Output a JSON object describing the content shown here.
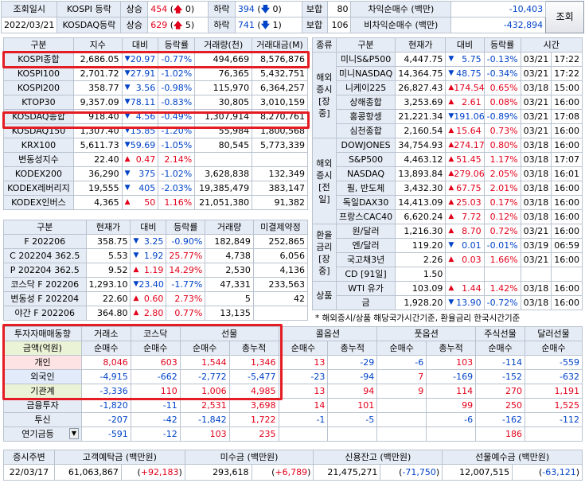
{
  "header": {
    "time_label": "조회일시",
    "date": "2022/03/21",
    "rows": [
      {
        "market": "KOSPI 등락",
        "up_label": "상승",
        "up_count": "454",
        "upper_limit": "0",
        "down_label": "하락",
        "down_count": "394",
        "lower_limit": "0",
        "flat_label": "보합",
        "flat_count": "80",
        "net_label": "차익순매수 (백만)",
        "net_value": "-10,403"
      },
      {
        "market": "KOSDAQ등락",
        "up_label": "상승",
        "up_count": "629",
        "upper_limit": "5",
        "down_label": "하락",
        "down_count": "741",
        "lower_limit": "1",
        "flat_label": "보합",
        "flat_count": "106",
        "net_label": "비차익순매수 (백만)",
        "net_value": "-432,894"
      }
    ],
    "query_button": "조회"
  },
  "index_table": {
    "headers": [
      "구분",
      "지수",
      "대비",
      "등락률",
      "거래량(천)",
      "거래대금(M)"
    ],
    "rows": [
      {
        "name": "KOSPI종합",
        "value": "2,686.05",
        "dir": "down",
        "change": "20.97",
        "rate": "-0.77%",
        "volume": "494,669",
        "amount": "8,576,876"
      },
      {
        "name": "KOSPI100",
        "value": "2,701.72",
        "dir": "down",
        "change": "27.91",
        "rate": "-1.02%",
        "volume": "76,365",
        "amount": "5,432,751"
      },
      {
        "name": "KOSPI200",
        "value": "358.77",
        "dir": "down",
        "change": "3.56",
        "rate": "-0.98%",
        "volume": "115,970",
        "amount": "6,364,257"
      },
      {
        "name": "KTOP30",
        "value": "9,357.09",
        "dir": "down",
        "change": "78.11",
        "rate": "-0.83%",
        "volume": "30,805",
        "amount": "3,010,159"
      },
      {
        "name": "KOSDAQ종합",
        "value": "918.40",
        "dir": "down",
        "change": "4.56",
        "rate": "-0.49%",
        "volume": "1,307,914",
        "amount": "8,270,761"
      },
      {
        "name": "KOSDAQ150",
        "value": "1,307.40",
        "dir": "down",
        "change": "15.85",
        "rate": "-1.20%",
        "volume": "55,984",
        "amount": "1,800,568"
      },
      {
        "name": "KRX100",
        "value": "5,611.73",
        "dir": "down",
        "change": "59.69",
        "rate": "-1.05%",
        "volume": "80,545",
        "amount": "5,773,339"
      },
      {
        "name": "변동성지수",
        "value": "22.40",
        "dir": "up",
        "change": "0.47",
        "rate": "2.14%",
        "volume": "",
        "amount": ""
      },
      {
        "name": "KODEX200",
        "value": "36,290",
        "dir": "down",
        "change": "375",
        "rate": "-1.02%",
        "volume": "3,628,838",
        "amount": "132,349"
      },
      {
        "name": "KODEX레버리지",
        "value": "19,555",
        "dir": "down",
        "change": "405",
        "rate": "-2.03%",
        "volume": "19,385,479",
        "amount": "383,147"
      },
      {
        "name": "KODEX인버스",
        "value": "4,365",
        "dir": "up",
        "change": "50",
        "rate": "1.16%",
        "volume": "21,051,380",
        "amount": "91,382"
      }
    ]
  },
  "futures_table": {
    "headers": [
      "구분",
      "현재가",
      "대비",
      "등락률",
      "거래량",
      "미결제약정"
    ],
    "rows": [
      {
        "name": "F 202206",
        "value": "358.75",
        "dir": "down",
        "change": "3.25",
        "rate": "-0.90%",
        "volume": "182,849",
        "oi": "252,865"
      },
      {
        "name": "C 202204 362.5",
        "value": "5.53",
        "dir": "down",
        "change": "1.92",
        "rate": "25.77%",
        "volume": "4,738",
        "oi": "6,056"
      },
      {
        "name": "P 202204 362.5",
        "value": "9.52",
        "dir": "up",
        "change": "1.19",
        "rate": "14.29%",
        "volume": "2,530",
        "oi": "4,136"
      },
      {
        "name": "코스닥 F 202206",
        "value": "1,293.10",
        "dir": "down",
        "change": "23.40",
        "rate": "-1.77%",
        "volume": "47,331",
        "oi": "233,563"
      },
      {
        "name": "변동성 F 202204",
        "value": "22.60",
        "dir": "up",
        "change": "0.60",
        "rate": "2.73%",
        "volume": "5",
        "oi": "42"
      },
      {
        "name": "야간 F 202206",
        "value": "364.80",
        "dir": "up",
        "change": "2.80",
        "rate": "0.77%",
        "volume": "13,135",
        "oi": ""
      }
    ]
  },
  "world_table": {
    "headers": [
      "종류",
      "구분",
      "현재가",
      "대비",
      "등락률",
      "시간"
    ],
    "groups": [
      {
        "label": "해외 증시 [장중]",
        "rows": [
          {
            "name": "미니S&P500",
            "value": "4,447.75",
            "dir": "down",
            "change": "5.75",
            "rate": "-0.13%",
            "date": "03/21",
            "time": "17:22"
          },
          {
            "name": "미니NASDAQ",
            "value": "14,364.75",
            "dir": "down",
            "change": "48.75",
            "rate": "-0.34%",
            "date": "03/21",
            "time": "17:22"
          },
          {
            "name": "니케이225",
            "value": "26,827.43",
            "dir": "up",
            "change": "174.54",
            "rate": "0.65%",
            "date": "03/18",
            "time": "15:00"
          },
          {
            "name": "상해종합",
            "value": "3,253.69",
            "dir": "up",
            "change": "2.61",
            "rate": "0.08%",
            "date": "03/21",
            "time": "16:00"
          },
          {
            "name": "홍콩항셍",
            "value": "21,221.34",
            "dir": "down",
            "change": "191.06",
            "rate": "-0.89%",
            "date": "03/21",
            "time": "17:08"
          },
          {
            "name": "심천종합",
            "value": "2,160.54",
            "dir": "up",
            "change": "15.64",
            "rate": "0.73%",
            "date": "03/21",
            "time": "16:00"
          }
        ]
      },
      {
        "label": "해외 증시 [전일]",
        "rows": [
          {
            "name": "DOWJONES",
            "value": "34,754.93",
            "dir": "up",
            "change": "274.17",
            "rate": "0.80%",
            "date": "03/18",
            "time": "16:00"
          },
          {
            "name": "S&P500",
            "value": "4,463.12",
            "dir": "up",
            "change": "51.45",
            "rate": "1.17%",
            "date": "03/18",
            "time": "17:07"
          },
          {
            "name": "NASDAQ",
            "value": "13,893.84",
            "dir": "up",
            "change": "279.06",
            "rate": "2.05%",
            "date": "03/18",
            "time": "16:01"
          },
          {
            "name": "필, 반도체",
            "value": "3,432.30",
            "dir": "up",
            "change": "67.75",
            "rate": "2.01%",
            "date": "03/18",
            "time": "16:00"
          },
          {
            "name": "독일DAX30",
            "value": "14,413.09",
            "dir": "up",
            "change": "25.03",
            "rate": "0.17%",
            "date": "03/18",
            "time": "16:00"
          },
          {
            "name": "프랑스CAC40",
            "value": "6,620.24",
            "dir": "up",
            "change": "7.72",
            "rate": "0.12%",
            "date": "03/18",
            "time": "16:00"
          }
        ]
      },
      {
        "label": "환율 금리 [장중]",
        "rows": [
          {
            "name": "원/달러",
            "value": "1,216.30",
            "dir": "up",
            "change": "8.70",
            "rate": "0.72%",
            "date": "03/21",
            "time": "16:00"
          },
          {
            "name": "엔/달러",
            "value": "119.20",
            "dir": "down",
            "change": "0.01",
            "rate": "-0.01%",
            "date": "03/19",
            "time": "06:59"
          },
          {
            "name": "국고채3년",
            "value": "2.26",
            "dir": "up",
            "change": "0.03",
            "rate": "1.66%",
            "date": "03/21",
            "time": "16:00"
          },
          {
            "name": "CD [91일]",
            "value": "1.50",
            "dir": "",
            "change": "",
            "rate": "",
            "date": "",
            "time": ""
          }
        ]
      },
      {
        "label": "상품",
        "rows": [
          {
            "name": "WTI 유가",
            "value": "103.09",
            "dir": "up",
            "change": "1.44",
            "rate": "1.42%",
            "date": "03/18",
            "time": "16:00"
          },
          {
            "name": "금",
            "value": "1,928.20",
            "dir": "down",
            "change": "13.90",
            "rate": "-0.72%",
            "date": "03/18",
            "time": "16:00"
          }
        ]
      }
    ],
    "note": "* 해외증시/상품 해당국가시간기준, 환율금리 한국시간기준"
  },
  "investor_table": {
    "title": "투자자매매동향",
    "unit": "금액(억원)",
    "groups": [
      "거래소",
      "코스닥",
      "선물",
      "콜옵션",
      "풋옵션",
      "주식선물",
      "달러선물"
    ],
    "subheaders": [
      "순매수",
      "순매수",
      "순매수",
      "총누적",
      "순매수",
      "총누적",
      "순매수",
      "총누적",
      "순매수",
      "순매수"
    ],
    "rows": [
      {
        "name": "개인",
        "values": [
          "8,046",
          "603",
          "1,544",
          "1,346",
          "13",
          "-29",
          "-6",
          "103",
          "-114",
          "-559"
        ]
      },
      {
        "name": "외국인",
        "values": [
          "-4,915",
          "-662",
          "-2,772",
          "-5,477",
          "-23",
          "-94",
          "7",
          "-169",
          "-152",
          "-632"
        ]
      },
      {
        "name": "기관계",
        "values": [
          "-3,336",
          "110",
          "1,006",
          "4,985",
          "13",
          "94",
          "9",
          "114",
          "270",
          "1,191"
        ]
      },
      {
        "name": "금융투자",
        "values": [
          "-1,820",
          "-11",
          "2,531",
          "3,698",
          "14",
          "101",
          "",
          "99",
          "250",
          "1,525"
        ]
      },
      {
        "name": "투신",
        "values": [
          "-207",
          "-42",
          "-1,842",
          "1,722",
          "-1",
          "-5",
          "",
          "-6",
          "-162",
          "-112"
        ]
      },
      {
        "name": "연기금등",
        "values": [
          "-591",
          "-12",
          "103",
          "235",
          "",
          "",
          "",
          "",
          "186",
          ""
        ]
      }
    ]
  },
  "bottom": {
    "headers": [
      "증시주변",
      "고객예탁금 (백만원)",
      "미수금 (백만원)",
      "신용잔고 (백만원)",
      "선물예수금 (백만원)"
    ],
    "date": "22/03/17",
    "deposit": "61,063,867",
    "deposit_chg": "+92,183",
    "receivable": "293,618",
    "receivable_chg": "+6,789",
    "credit": "21,475,271",
    "credit_chg": "-71,750",
    "fut_deposit": "12,007,515",
    "fut_deposit_chg": "-63,121"
  },
  "colors": {
    "up": "#e2001a",
    "down": "#0043c8",
    "highlight": "#e41c23"
  },
  "icons": {
    "up": "arrow-up-icon",
    "down": "arrow-down-icon",
    "combo": "chevron-down-icon"
  }
}
